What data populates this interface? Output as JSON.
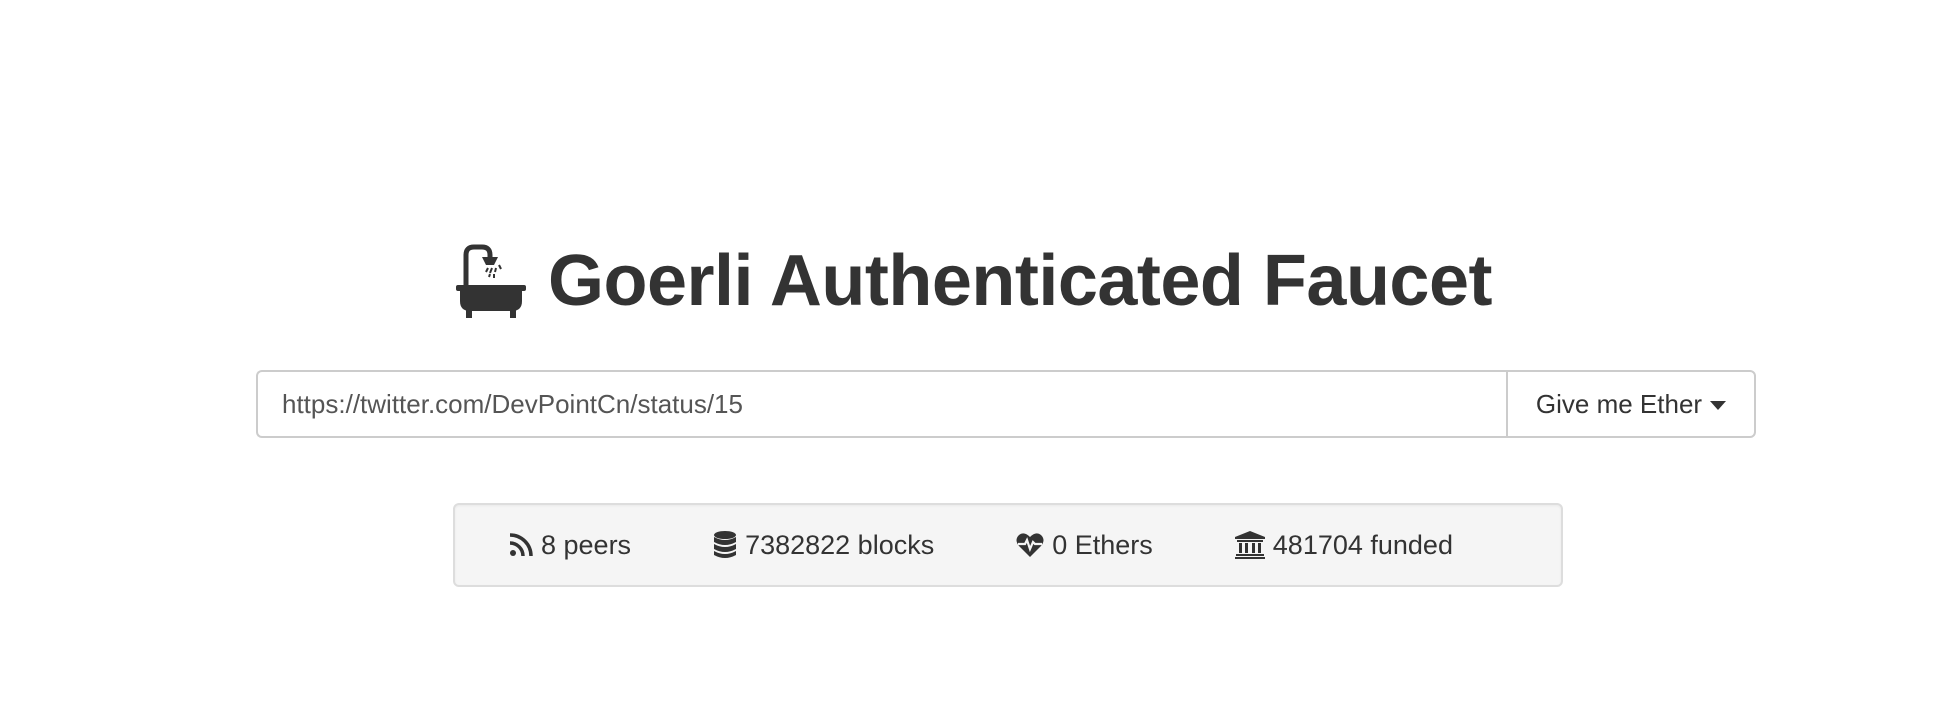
{
  "header": {
    "icon": "bath-icon",
    "title": "Goerli Authenticated Faucet"
  },
  "form": {
    "url_value": "https://twitter.com/DevPointCn/status/15",
    "button_label": "Give me Ether",
    "button_icon": "caret-down-icon"
  },
  "stats": {
    "peers": {
      "icon": "rss-icon",
      "label": "8 peers"
    },
    "blocks": {
      "icon": "database-icon",
      "label": "7382822 blocks"
    },
    "ethers": {
      "icon": "heartbeat-icon",
      "label": "0 Ethers"
    },
    "funded": {
      "icon": "bank-icon",
      "label": "481704 funded"
    }
  },
  "colors": {
    "text": "#333333",
    "well_background": "#f5f5f5",
    "border": "#cccccc"
  }
}
